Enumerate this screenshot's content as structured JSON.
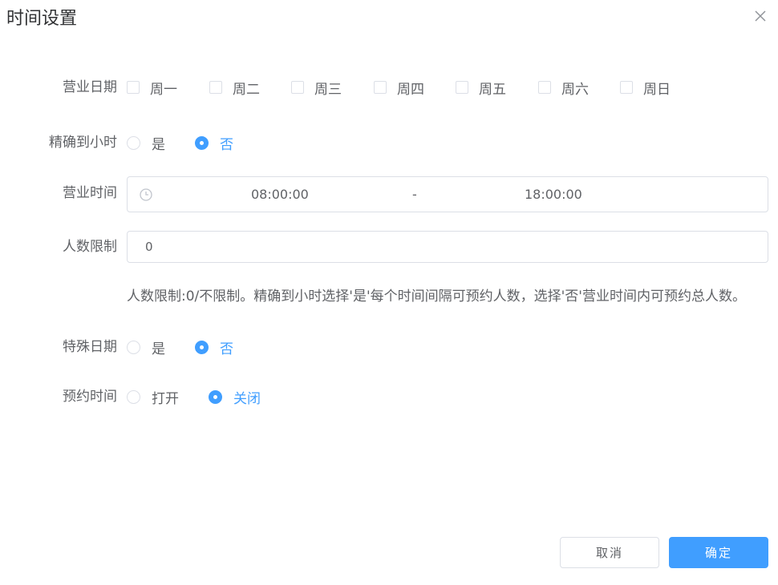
{
  "dialog": {
    "title": "时间设置",
    "close_icon": "close-icon"
  },
  "form": {
    "business_days": {
      "label": "营业日期",
      "options": [
        "周一",
        "周二",
        "周三",
        "周四",
        "周五",
        "周六",
        "周日"
      ],
      "checked": [
        false,
        false,
        false,
        false,
        false,
        false,
        false
      ]
    },
    "precise_hour": {
      "label": "精确到小时",
      "options": [
        "是",
        "否"
      ],
      "selected": "否"
    },
    "business_hours": {
      "label": "营业时间",
      "start": "08:00:00",
      "separator": "-",
      "end": "18:00:00",
      "icon": "clock-icon"
    },
    "people_limit": {
      "label": "人数限制",
      "value": "0",
      "hint": "人数限制:0/不限制。精确到小时选择'是'每个时间间隔可预约人数，选择'否'营业时间内可预约总人数。"
    },
    "special_date": {
      "label": "特殊日期",
      "options": [
        "是",
        "否"
      ],
      "selected": "否"
    },
    "booking_time": {
      "label": "预约时间",
      "options": [
        "打开",
        "关闭"
      ],
      "selected": "关闭"
    }
  },
  "footer": {
    "cancel_label": "取消",
    "ok_label": "确定"
  },
  "colors": {
    "primary": "#409eff",
    "border": "#dcdfe6",
    "text": "#606266",
    "title": "#303133"
  }
}
